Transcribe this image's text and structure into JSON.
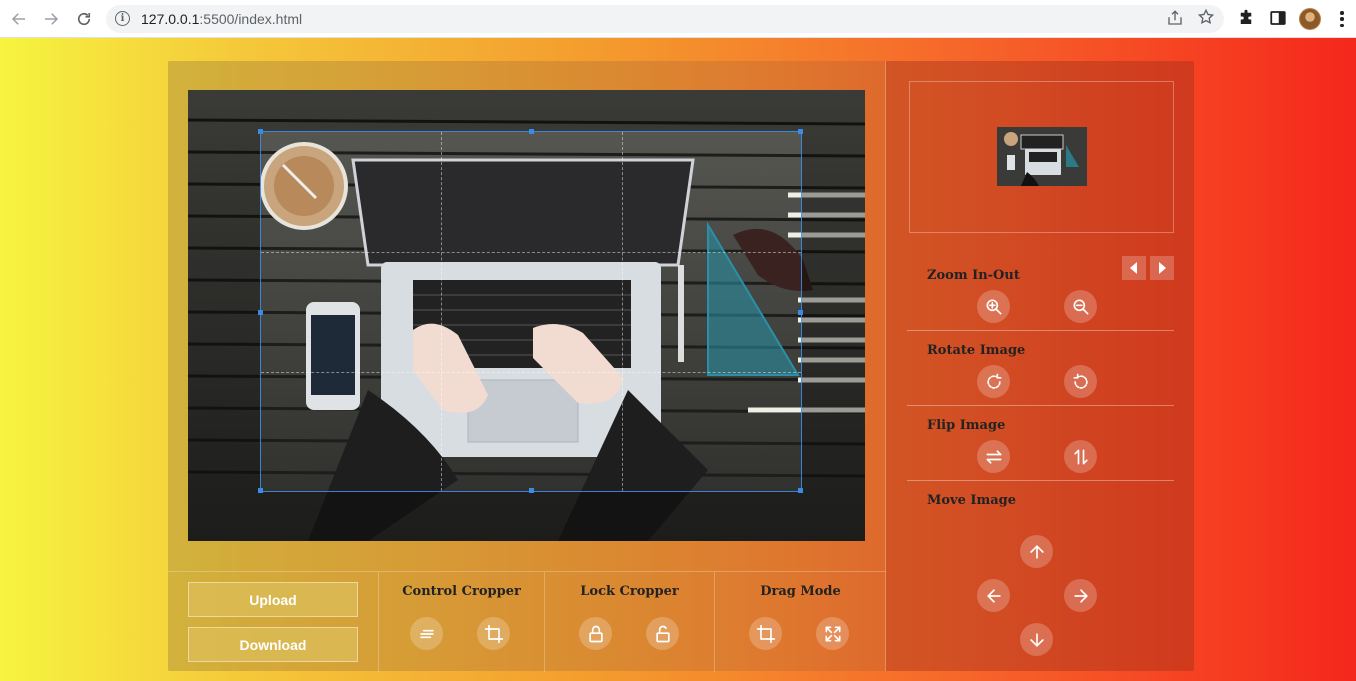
{
  "browser": {
    "url_host": "127.0.0.1",
    "url_path": ":5500/index.html"
  },
  "buttons": {
    "upload": "Upload",
    "download": "Download"
  },
  "groups": {
    "control_cropper": "Control Cropper",
    "lock_cropper": "Lock Cropper",
    "drag_mode": "Drag Mode"
  },
  "panel": {
    "zoom": "Zoom In-Out",
    "rotate": "Rotate Image",
    "flip": "Flip Image",
    "move": "Move Image"
  },
  "icons": {
    "control_cropper": [
      "align-lines-icon",
      "crop-icon"
    ],
    "lock_cropper": [
      "lock-icon",
      "unlock-icon"
    ],
    "drag_mode": [
      "crop-icon",
      "expand-icon"
    ],
    "zoom": [
      "zoom-in-icon",
      "zoom-out-icon"
    ],
    "rotate": [
      "rotate-right-icon",
      "rotate-left-icon"
    ],
    "flip": [
      "flip-horizontal-icon",
      "flip-vertical-icon"
    ],
    "move": [
      "arrow-up-icon",
      "arrow-left-icon",
      "arrow-right-icon",
      "arrow-down-icon"
    ],
    "pager": [
      "caret-left-icon",
      "caret-right-icon"
    ]
  },
  "colors": {
    "page_gradient": [
      "#f6f43f",
      "#f49a2d",
      "#f5271c"
    ],
    "crop_border": "#3a8ae6"
  }
}
